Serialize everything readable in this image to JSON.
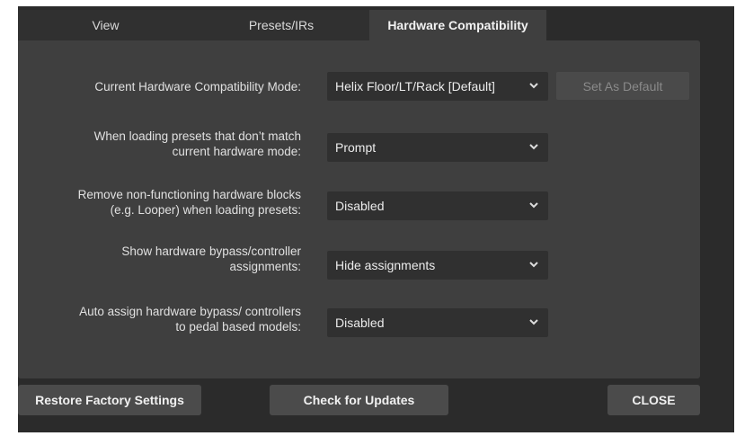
{
  "tabs": [
    {
      "label": "View"
    },
    {
      "label": "Presets/IRs"
    },
    {
      "label": "Hardware Compatibility"
    }
  ],
  "settings": [
    {
      "label_lines": [
        "Current Hardware Compatibility Mode:"
      ],
      "value": "Helix Floor/LT/Rack [Default]"
    },
    {
      "label_lines": [
        "When loading presets that don’t match",
        "current hardware mode:"
      ],
      "value": "Prompt"
    },
    {
      "label_lines": [
        "Remove non-functioning hardware blocks",
        "(e.g. Looper) when loading presets:"
      ],
      "value": "Disabled"
    },
    {
      "label_lines": [
        "Show hardware bypass/controller",
        "assignments:"
      ],
      "value": "Hide assignments"
    },
    {
      "label_lines": [
        "Auto assign hardware bypass/ controllers",
        "to pedal based models:"
      ],
      "value": "Disabled"
    }
  ],
  "set_default_label": "Set As Default",
  "footer": {
    "restore_label": "Restore Factory Settings",
    "updates_label": "Check for Updates",
    "close_label": "CLOSE"
  },
  "icons": {
    "dropdown": "chevron-down-icon"
  },
  "colors": {
    "window_bg": "#2b2b2b",
    "panel_bg": "#3f3f3f",
    "select_bg": "#303030",
    "button_bg": "#4b4b4b",
    "disabled_text": "#8a8a8a"
  }
}
